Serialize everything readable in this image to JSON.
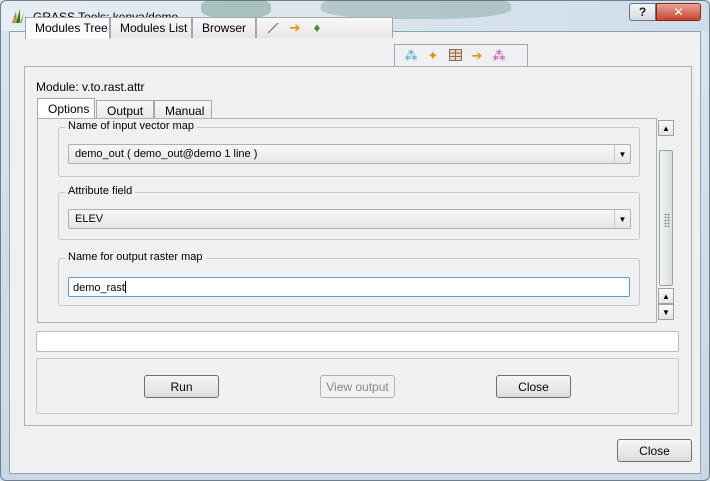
{
  "window": {
    "title": "GRASS Tools: kenya/demo",
    "help_label": "?",
    "close_label": "✕"
  },
  "top_tabs": [
    {
      "label": "Modules Tree",
      "active": true
    },
    {
      "label": "Modules List",
      "active": false
    },
    {
      "label": "Browser",
      "active": false
    }
  ],
  "module": {
    "label": "Module: v.to.rast.attr"
  },
  "sub_tabs": [
    {
      "label": "Options",
      "active": true
    },
    {
      "label": "Output",
      "active": false
    },
    {
      "label": "Manual",
      "active": false
    }
  ],
  "options": {
    "input_group_title": "Name of input vector map",
    "input_value": "demo_out ( demo_out@demo 1 line )",
    "attribute_group_title": "Attribute field",
    "attribute_value": "ELEV",
    "output_group_title": "Name for output raster map",
    "output_value": "demo_rast"
  },
  "buttons": {
    "run": "Run",
    "view_output": "View output",
    "close": "Close",
    "dialog_close": "Close"
  }
}
